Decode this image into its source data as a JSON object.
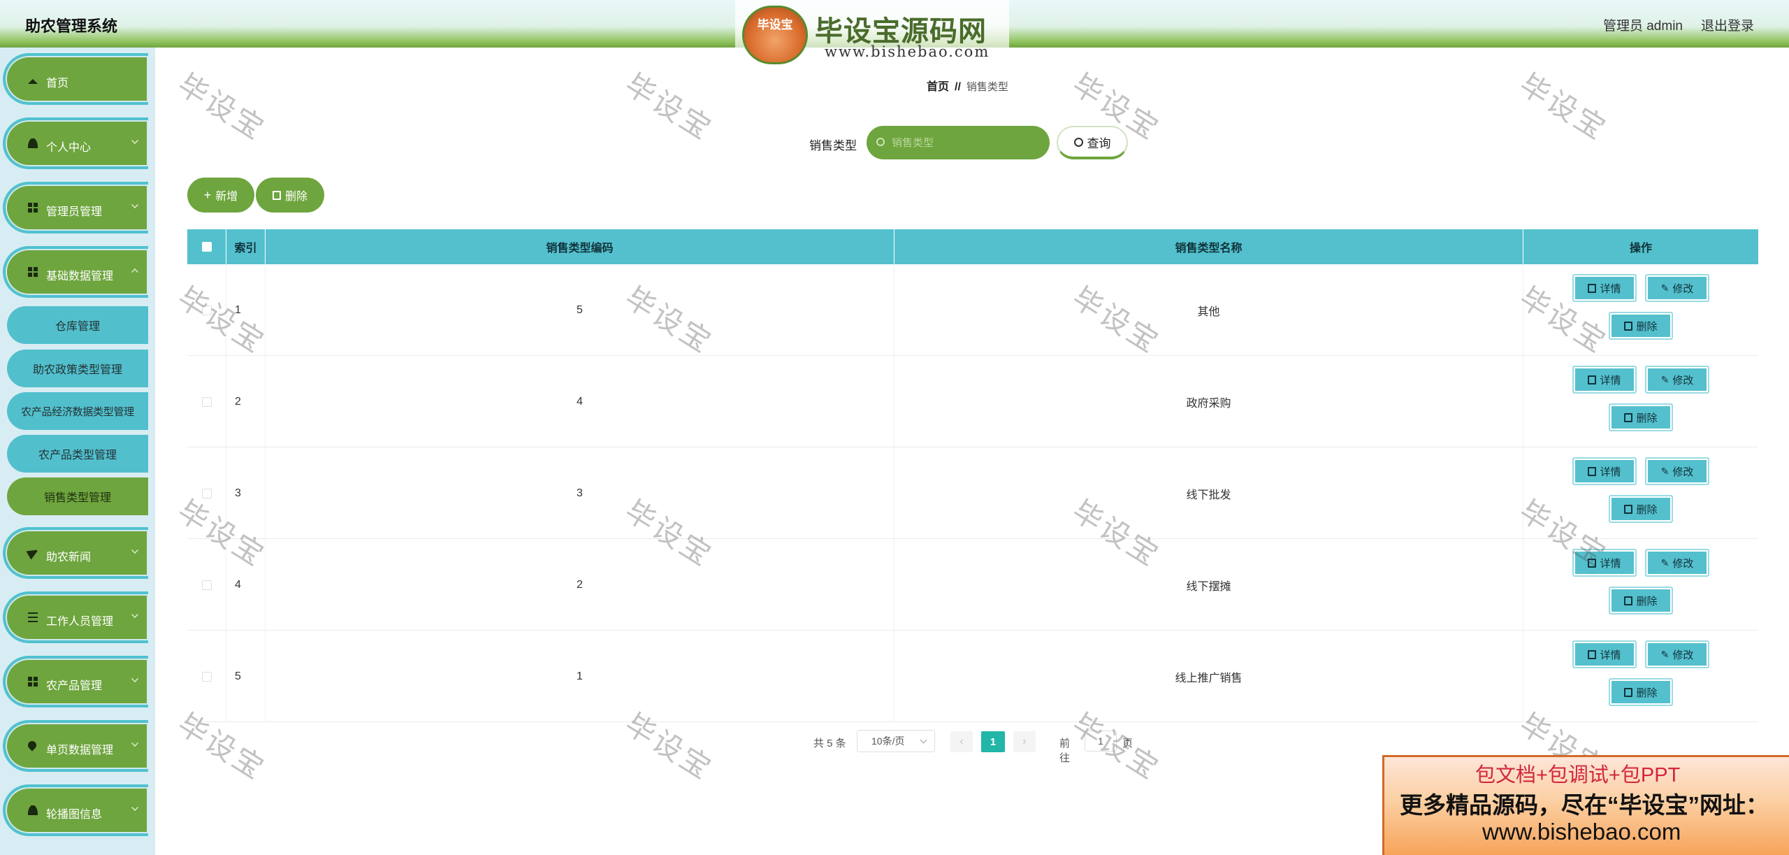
{
  "header": {
    "title": "助农管理系统",
    "user_label": "管理员 admin",
    "logout_label": "退出登录"
  },
  "logo": {
    "badge": "毕设宝",
    "name": "毕设宝源码网",
    "url": "www.bishebao.com"
  },
  "sidebar": {
    "items": [
      {
        "label": "首页",
        "icon": "home-icon"
      },
      {
        "label": "个人中心",
        "icon": "user-icon"
      },
      {
        "label": "管理员管理",
        "icon": "grid-icon"
      },
      {
        "label": "基础数据管理",
        "icon": "grid-icon"
      },
      {
        "label": "助农新闻",
        "icon": "send-icon"
      },
      {
        "label": "工作人员管理",
        "icon": "list-icon"
      },
      {
        "label": "农产品管理",
        "icon": "grid-icon"
      },
      {
        "label": "单页数据管理",
        "icon": "pin-icon"
      },
      {
        "label": "轮播图信息",
        "icon": "user-icon"
      }
    ],
    "sub_items": [
      {
        "label": "仓库管理"
      },
      {
        "label": "助农政策类型管理"
      },
      {
        "label": "农产品经济数据类型管理"
      },
      {
        "label": "农产品类型管理"
      },
      {
        "label": "销售类型管理"
      }
    ]
  },
  "breadcrumb": {
    "home": "首页",
    "separator": "//",
    "current": "销售类型"
  },
  "search": {
    "label": "销售类型",
    "placeholder": "销售类型",
    "query_label": "查询"
  },
  "actions": {
    "add_label": "新增",
    "delete_label": "删除"
  },
  "table": {
    "headers": {
      "index": "索引",
      "code": "销售类型编码",
      "name": "销售类型名称",
      "ops": "操作"
    },
    "rows": [
      {
        "index": "1",
        "code": "5",
        "name": "其他"
      },
      {
        "index": "2",
        "code": "4",
        "name": "政府采购"
      },
      {
        "index": "3",
        "code": "3",
        "name": "线下批发"
      },
      {
        "index": "4",
        "code": "2",
        "name": "线下摆摊"
      },
      {
        "index": "5",
        "code": "1",
        "name": "线上推广销售"
      }
    ],
    "op_labels": {
      "detail": "详情",
      "edit": "修改",
      "delete": "删除"
    }
  },
  "pagination": {
    "total": "共 5 条",
    "page_size": "10条/页",
    "current_page": "1",
    "goto_label": "前往",
    "goto_value": "1",
    "page_suffix": "页"
  },
  "watermark": {
    "text": "毕设宝"
  },
  "ad_banner": {
    "line1": "包文档+包调试+包PPT",
    "line2": "更多精品源码，尽在“毕设宝”网址：",
    "line3": "www.bishebao.com"
  },
  "colors": {
    "green": "#6ea53e",
    "teal": "#54c0cd",
    "page_active": "#21b6a8"
  }
}
